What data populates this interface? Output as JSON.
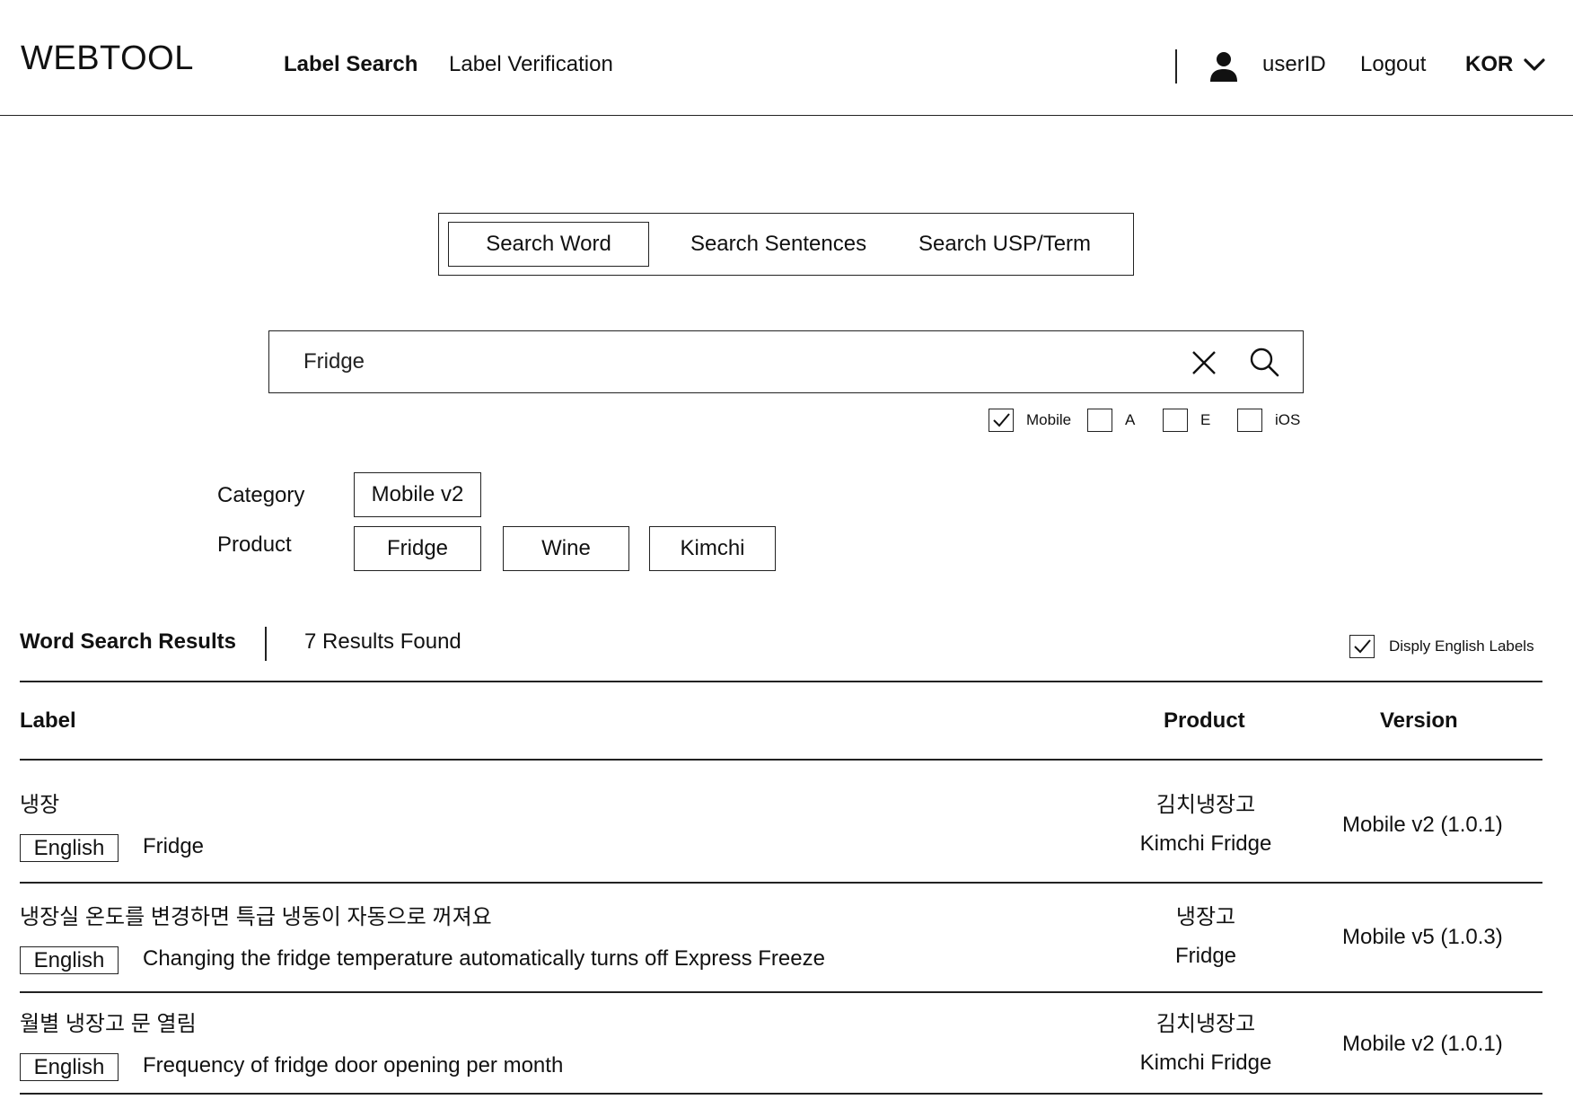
{
  "header": {
    "logo": "WEBTOOL",
    "nav": [
      "Label Search",
      "Label Verification"
    ],
    "user_id": "userID",
    "logout": "Logout",
    "language": "KOR"
  },
  "search_modes": [
    "Search Word",
    "Search Sentences",
    "Search USP/Term"
  ],
  "active_mode": "Search Word",
  "search": {
    "value": "Fridge"
  },
  "platforms": [
    {
      "label": "Mobile",
      "checked": true
    },
    {
      "label": "A",
      "checked": false
    },
    {
      "label": "E",
      "checked": false
    },
    {
      "label": "iOS",
      "checked": false
    }
  ],
  "filters": {
    "category_label": "Category",
    "category_value": "Mobile v2",
    "product_label": "Product",
    "products": [
      "Fridge",
      "Wine",
      "Kimchi"
    ]
  },
  "results": {
    "title": "Word Search Results",
    "count": "7 Results Found",
    "display_english_label": "Disply English Labels",
    "display_english_checked": true
  },
  "table": {
    "columns": [
      "Label",
      "Product",
      "Version"
    ],
    "english_tag": "English",
    "rows": [
      {
        "label_ko": "냉장",
        "label_en": "Fridge",
        "product_ko": "김치냉장고",
        "product_en": "Kimchi Fridge",
        "version": "Mobile v2 (1.0.1)"
      },
      {
        "label_ko": "냉장실 온도를 변경하면 특급 냉동이 자동으로 꺼져요",
        "label_en": "Changing the fridge temperature automatically turns off Express Freeze",
        "product_ko": "냉장고",
        "product_en": "Fridge",
        "version": "Mobile v5 (1.0.3)"
      },
      {
        "label_ko": "월별 냉장고 문 열림",
        "label_en": "Frequency of fridge door opening per month",
        "product_ko": "김치냉장고",
        "product_en": "Kimchi Fridge",
        "version": "Mobile v2 (1.0.1)"
      }
    ]
  }
}
